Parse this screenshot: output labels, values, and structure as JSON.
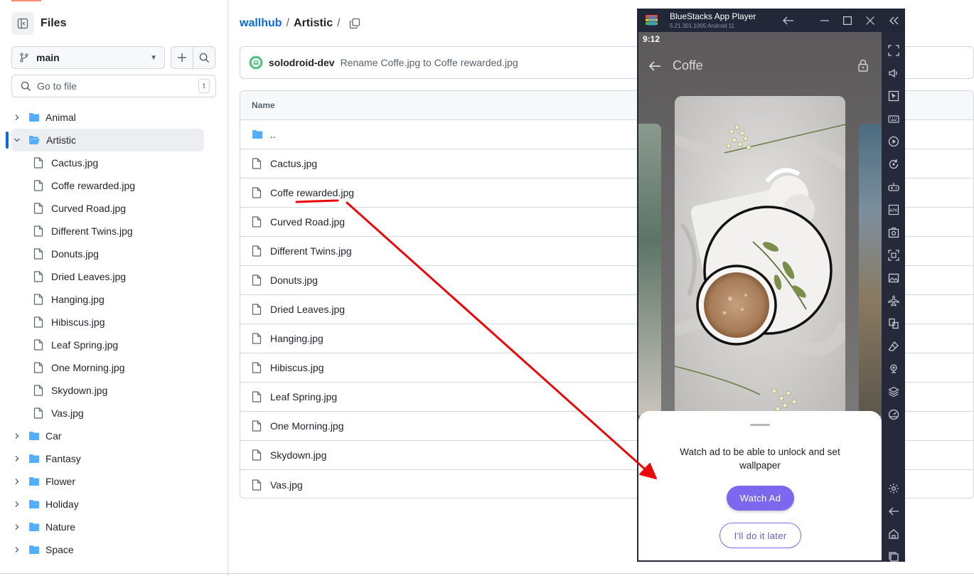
{
  "sidebar": {
    "title": "Files",
    "branch": "main",
    "goto_placeholder": "Go to file",
    "goto_shortcut": "t",
    "tree": [
      {
        "label": "Animal",
        "type": "folder",
        "expanded": false
      },
      {
        "label": "Artistic",
        "type": "folder",
        "expanded": true,
        "selected": true
      },
      {
        "label": "Cactus.jpg",
        "type": "file"
      },
      {
        "label": "Coffe rewarded.jpg",
        "type": "file"
      },
      {
        "label": "Curved Road.jpg",
        "type": "file"
      },
      {
        "label": "Different Twins.jpg",
        "type": "file"
      },
      {
        "label": "Donuts.jpg",
        "type": "file"
      },
      {
        "label": "Dried Leaves.jpg",
        "type": "file"
      },
      {
        "label": "Hanging.jpg",
        "type": "file"
      },
      {
        "label": "Hibiscus.jpg",
        "type": "file"
      },
      {
        "label": "Leaf Spring.jpg",
        "type": "file"
      },
      {
        "label": "One Morning.jpg",
        "type": "file"
      },
      {
        "label": "Skydown.jpg",
        "type": "file"
      },
      {
        "label": "Vas.jpg",
        "type": "file"
      },
      {
        "label": "Car",
        "type": "folder",
        "expanded": false
      },
      {
        "label": "Fantasy",
        "type": "folder",
        "expanded": false
      },
      {
        "label": "Flower",
        "type": "folder",
        "expanded": false
      },
      {
        "label": "Holiday",
        "type": "folder",
        "expanded": false
      },
      {
        "label": "Nature",
        "type": "folder",
        "expanded": false
      },
      {
        "label": "Space",
        "type": "folder",
        "expanded": false
      }
    ]
  },
  "breadcrumb": {
    "repo": "wallhub",
    "sep1": "/",
    "dir": "Artistic",
    "sep2": "/"
  },
  "commit": {
    "author": "solodroid-dev",
    "message": "Rename Coffe.jpg to Coffe rewarded.jpg"
  },
  "table": {
    "header": "Name",
    "rows": [
      {
        "label": "..",
        "type": "folder"
      },
      {
        "label": "Cactus.jpg",
        "type": "file"
      },
      {
        "label": "Coffe rewarded.jpg",
        "type": "file"
      },
      {
        "label": "Curved Road.jpg",
        "type": "file"
      },
      {
        "label": "Different Twins.jpg",
        "type": "file"
      },
      {
        "label": "Donuts.jpg",
        "type": "file"
      },
      {
        "label": "Dried Leaves.jpg",
        "type": "file"
      },
      {
        "label": "Hanging.jpg",
        "type": "file"
      },
      {
        "label": "Hibiscus.jpg",
        "type": "file"
      },
      {
        "label": "Leaf Spring.jpg",
        "type": "file"
      },
      {
        "label": "One Morning.jpg",
        "type": "file"
      },
      {
        "label": "Skydown.jpg",
        "type": "file"
      },
      {
        "label": "Vas.jpg",
        "type": "file"
      }
    ]
  },
  "bluestacks": {
    "title": "BlueStacks App Player",
    "version": "5.21.301.1005  Android 11",
    "status_time": "9:12",
    "app_title": "Coffe",
    "sheet_message": "Watch ad to be able to unlock and set wallpaper",
    "watch_button": "Watch Ad",
    "later_button": "I'll do it later",
    "side_icons": [
      "fullscreen-icon",
      "volume-icon",
      "cursor-icon",
      "keyboard-icon",
      "play-icon",
      "rotate-sync-icon",
      "gamepad-icon",
      "apk-icon",
      "screenshot-icon",
      "record-icon",
      "gallery-icon",
      "airplane-icon",
      "copy-icon",
      "eraser-icon",
      "location-icon",
      "layers-icon",
      "speedometer-icon",
      "settings-icon",
      "back-icon",
      "home-icon",
      "recents-icon"
    ]
  },
  "colors": {
    "link": "#0969da",
    "folder": "#54aeff",
    "accent_purple": "#7b68ee",
    "annotation": "#e8090a",
    "bluestacks_bg": "#252939"
  }
}
